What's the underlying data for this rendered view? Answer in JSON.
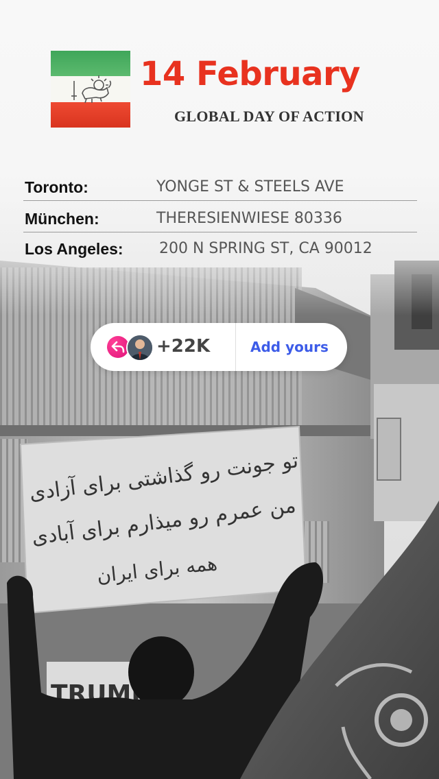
{
  "header": {
    "title": "14 February",
    "subtitle": "GLOBAL DAY OF ACTION"
  },
  "locations": [
    {
      "city": "Toronto:",
      "address": "YONGE ST & STEELS AVE"
    },
    {
      "city": "München:",
      "address": "THERESIENWIESE 80336"
    },
    {
      "city": "Los Angeles:",
      "address": "200 N SPRING ST, CA 90012"
    }
  ],
  "add_yours_sticker": {
    "count": "+22K",
    "button_label": "Add yours",
    "reply_icon": "reply-arrow-icon",
    "accent_color": "#e0147a",
    "button_color": "#3d5ce8"
  },
  "colors": {
    "title_red": "#e8321f",
    "flag_green": "#3fa65a",
    "flag_white": "#f7f7f2",
    "flag_red": "#e8321f"
  },
  "photo": {
    "sign_lines": [
      "تو جونت رو گذاشتی برای آزادی",
      "من عمرم رو میذارم برای آبادی",
      "همه برای ایران"
    ],
    "banner_text": "TRUMP"
  }
}
